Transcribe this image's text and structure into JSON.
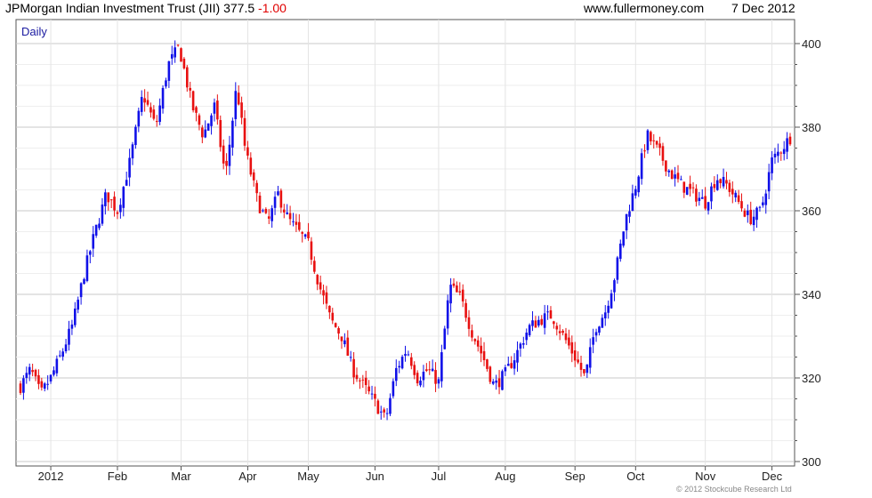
{
  "header": {
    "title": "JPMorgan Indian Investment Trust (JII) 377.5",
    "change": "-1.00",
    "site": "www.fullermoney.com",
    "date": "7 Dec 2012"
  },
  "footer": {
    "copyright": "© 2012 Stockcube Research Ltd"
  },
  "colors": {
    "up": "#1010e8",
    "down": "#e81010",
    "grid": "#dcdcdc",
    "period_label": "#1a1aa0"
  },
  "chart_data": {
    "type": "candlestick",
    "period_label": "Daily",
    "y_axis_side": "right",
    "ylim": [
      300,
      400
    ],
    "y_ticks": [
      300,
      320,
      340,
      360,
      380,
      400
    ],
    "x_ticks": [
      "2012",
      "Feb",
      "Mar",
      "Apr",
      "May",
      "Jun",
      "Jul",
      "Aug",
      "Sep",
      "Oct",
      "Nov",
      "Dec"
    ],
    "grid": true,
    "month_segments": [
      {
        "month": "Dec 2011",
        "days": 10,
        "points": [
          318,
          322,
          316,
          320
        ]
      },
      {
        "month": "2012",
        "days": 22,
        "points": [
          320,
          326,
          333,
          345,
          355,
          364,
          360
        ]
      },
      {
        "month": "Feb",
        "days": 21,
        "points": [
          360,
          372,
          388,
          380,
          395,
          400
        ]
      },
      {
        "month": "Mar",
        "days": 22,
        "points": [
          397,
          385,
          378,
          385,
          368,
          390,
          370
        ]
      },
      {
        "month": "Apr",
        "days": 20,
        "points": [
          372,
          362,
          357,
          364,
          358,
          355,
          352
        ]
      },
      {
        "month": "May",
        "days": 22,
        "points": [
          352,
          342,
          334,
          330,
          322,
          318,
          314
        ]
      },
      {
        "month": "Jun",
        "days": 21,
        "points": [
          314,
          310,
          322,
          327,
          320,
          322,
          319
        ]
      },
      {
        "month": "Jul",
        "days": 22,
        "points": [
          319,
          342,
          339,
          331,
          325,
          318,
          321
        ]
      },
      {
        "month": "Aug",
        "days": 23,
        "points": [
          321,
          326,
          332,
          334,
          335,
          330,
          325
        ]
      },
      {
        "month": "Sep",
        "days": 20,
        "points": [
          325,
          320,
          332,
          336,
          345,
          358,
          366
        ]
      },
      {
        "month": "Oct",
        "days": 23,
        "points": [
          366,
          378,
          374,
          369,
          366,
          364,
          362
        ]
      },
      {
        "month": "Nov",
        "days": 22,
        "points": [
          362,
          368,
          366,
          362,
          358,
          360,
          372
        ]
      },
      {
        "month": "Dec",
        "days": 6,
        "points": [
          372,
          377.5
        ]
      }
    ]
  }
}
